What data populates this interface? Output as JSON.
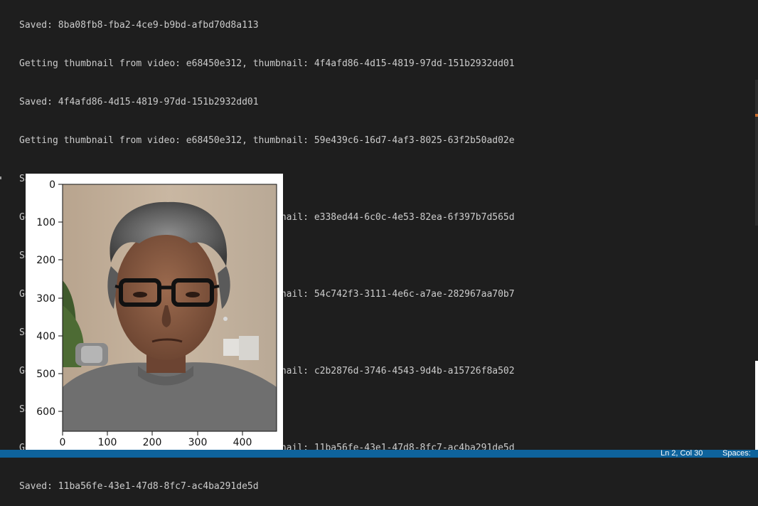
{
  "output": {
    "lines": [
      "Saved: 8ba08fb8-fba2-4ce9-b9bd-afbd70d8a113",
      "Getting thumbnail from video: e68450e312, thumbnail: 4f4afd86-4d15-4819-97dd-151b2932dd01",
      "Saved: 4f4afd86-4d15-4819-97dd-151b2932dd01",
      "Getting thumbnail from video: e68450e312, thumbnail: 59e439c6-16d7-4af3-8025-63f2b50ad02e",
      "Saved: 59e439c6-16d7-4af3-8025-63f2b50ad02e",
      "Getting thumbnail from video: e68450e312, thumbnail: e338ed44-6c0c-4e53-82ea-6f397b7d565d",
      "Saved: e338ed44-6c0c-4e53-82ea-6f397b7d565d",
      "Getting thumbnail from video: e68450e312, thumbnail: 54c742f3-3111-4e6c-a7ae-282967aa70b7",
      "Saved: 54c742f3-3111-4e6c-a7ae-282967aa70b7",
      "Getting thumbnail from video: e68450e312, thumbnail: c2b2876d-3746-4543-9d4b-a15726f8a502",
      "Saved: c2b2876d-3746-4543-9d4b-a15726f8a502",
      "Getting thumbnail from video: e68450e312, thumbnail: 11ba56fe-43e1-47d8-8fc7-ac4ba291de5d",
      "Saved: 11ba56fe-43e1-47d8-8fc7-ac4ba291de5d"
    ]
  },
  "plot": {
    "y_ticks": [
      "0",
      "100",
      "200",
      "300",
      "400",
      "500",
      "600"
    ],
    "x_ticks": [
      "0",
      "100",
      "200",
      "300",
      "400"
    ],
    "image_icon": "portrait-photo-icon"
  },
  "status_bar": {
    "position": "Ln 2, Col 30",
    "spaces": "Spaces:"
  },
  "colors": {
    "background": "#1e1e1e",
    "text": "#cccccc",
    "status_bar": "#0e639c"
  }
}
